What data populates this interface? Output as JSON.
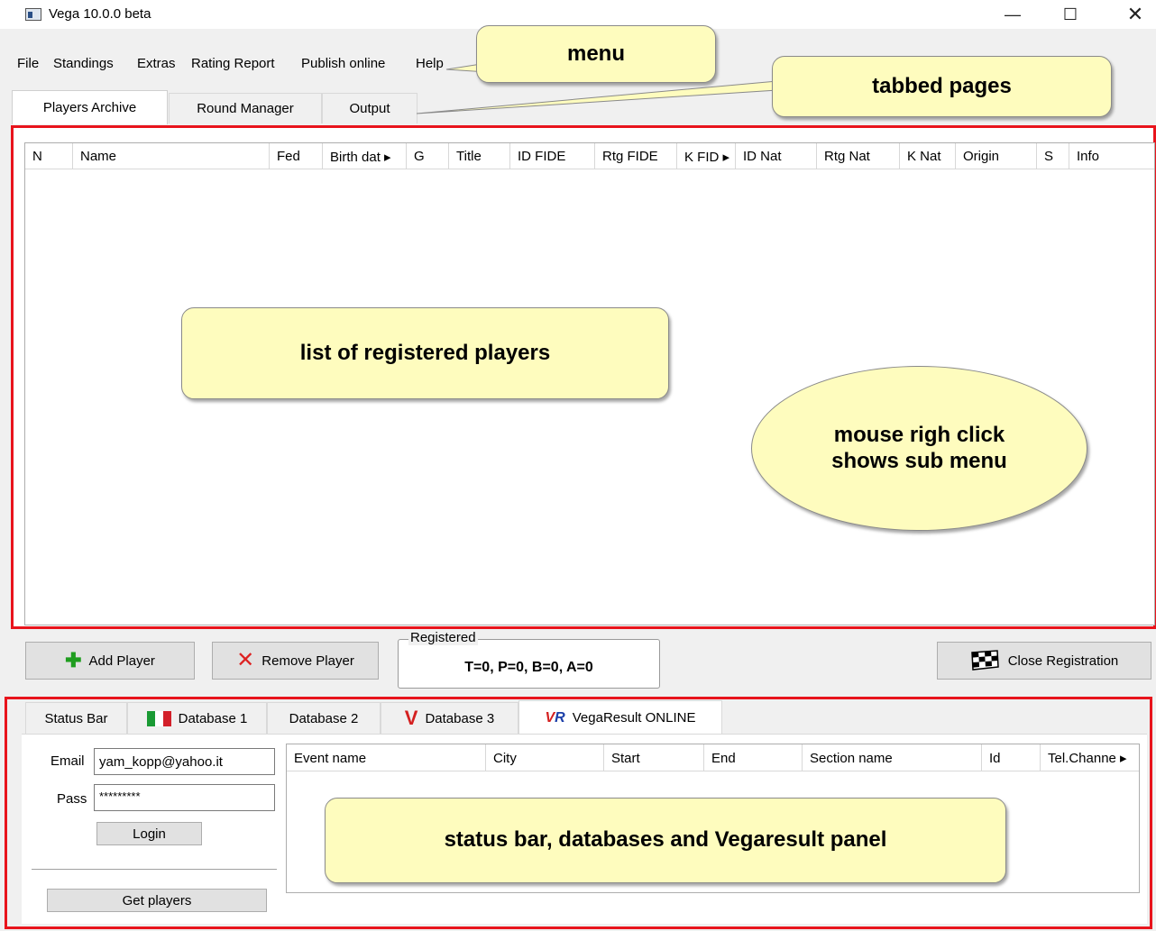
{
  "window": {
    "title": "Vega 10.0.0 beta",
    "controls": {
      "minimize": "—",
      "maximize": "☐",
      "close": "✕"
    }
  },
  "menu": {
    "items": [
      "File",
      "Standings",
      "Extras",
      "Rating Report",
      "Publish online",
      "Help"
    ]
  },
  "tabs": {
    "items": [
      "Players Archive",
      "Round Manager",
      "Output"
    ],
    "active": "Players Archive"
  },
  "players_table": {
    "columns": [
      "N",
      "Name",
      "Fed",
      "Birth dat ▸",
      "G",
      "Title",
      "ID FIDE",
      "Rtg FIDE",
      "K FID ▸",
      "ID Nat",
      "Rtg Nat",
      "K Nat",
      "Origin",
      "S",
      "Info"
    ],
    "rows": []
  },
  "actions": {
    "add_player": "Add Player",
    "remove_player": "Remove Player",
    "registered_legend": "Registered",
    "registered_value": "T=0, P=0, B=0, A=0",
    "close_registration": "Close Registration"
  },
  "bottom_tabs": {
    "items": [
      "Status Bar",
      "Database 1",
      "Database 2",
      "Database 3",
      "VegaResult ONLINE"
    ],
    "active": "VegaResult ONLINE"
  },
  "vegaresult": {
    "email_label": "Email",
    "email_value": "yam_kopp@yahoo.it",
    "pass_label": "Pass",
    "pass_value": "*********",
    "login_label": "Login",
    "get_players_label": "Get players",
    "events_columns": [
      "Event name",
      "City",
      "Start",
      "End",
      "Section name",
      "Id",
      "Tel.Channe ▸"
    ]
  },
  "callouts": {
    "menu": "menu",
    "tabbed_pages": "tabbed pages",
    "list": "list of registered players",
    "mouse_line1": "mouse righ click",
    "mouse_line2": "shows sub menu",
    "status": "status bar, databases and Vegaresult panel"
  },
  "colors": {
    "highlight_border": "#e8141c",
    "callout_fill": "#fefcbe",
    "window_bg": "#f0f0f0"
  }
}
